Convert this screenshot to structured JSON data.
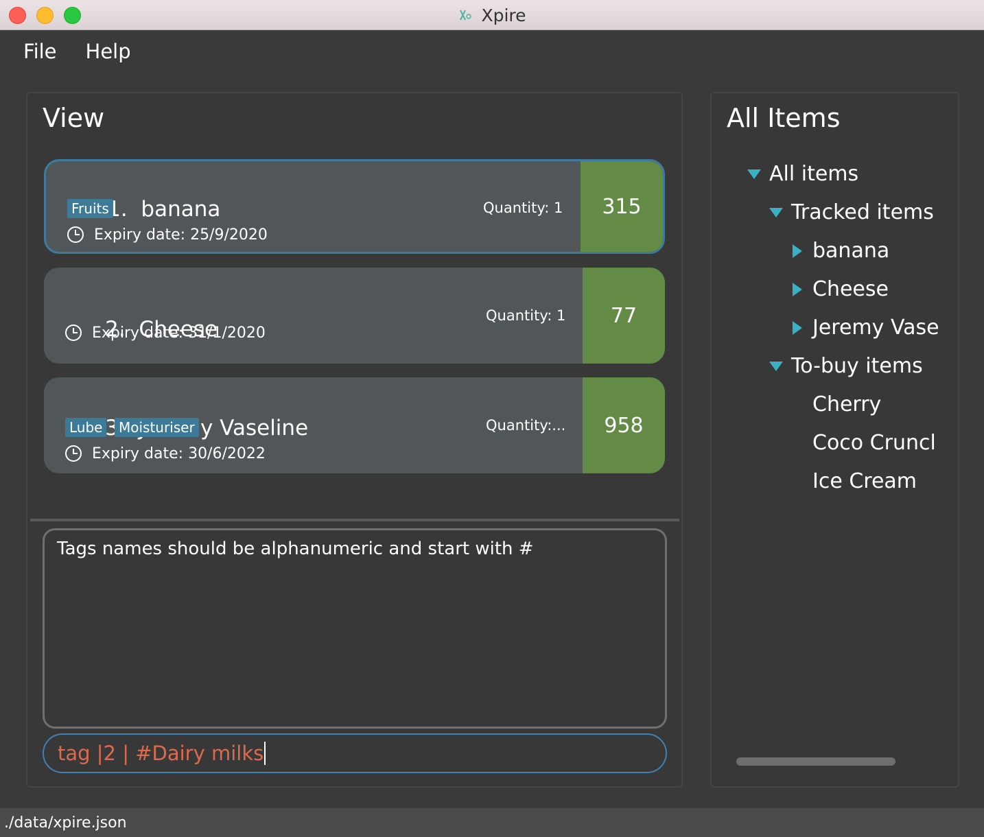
{
  "window": {
    "title": "Xpire",
    "icon": "xpire-logo-icon"
  },
  "menu": {
    "items": [
      "File",
      "Help"
    ]
  },
  "view_panel": {
    "title": "View",
    "cards": [
      {
        "index": "1.",
        "name": "banana",
        "tags": [
          "Fruits"
        ],
        "quantity": "Quantity: 1",
        "expiry": "Expiry date: 25/9/2020",
        "days": "315",
        "selected": true
      },
      {
        "index": "2.",
        "name": "Cheese",
        "tags": [],
        "quantity": "Quantity: 1",
        "expiry": "Expiry date: 31/1/2020",
        "days": "77",
        "selected": false
      },
      {
        "index": "3.",
        "name": "Jeremy Vaseline",
        "tags": [
          "Lube",
          "Moisturiser"
        ],
        "quantity": "Quantity:...",
        "expiry": "Expiry date: 30/6/2022",
        "days": "958",
        "selected": false
      }
    ],
    "badge_color": "#638b45",
    "tag_color": "#3c7a97"
  },
  "result": {
    "text": "Tags names should be alphanumeric and start with #"
  },
  "command": {
    "value": "tag |2 | #Dairy milks",
    "text_color": "#dd6a4d"
  },
  "items_panel": {
    "title": "All Items",
    "tree": {
      "root": "All items",
      "tracked_label": "Tracked items",
      "tracked": [
        "banana",
        "Cheese",
        "Jeremy Vase"
      ],
      "tobuy_label": "To-buy items",
      "tobuy": [
        "Cherry",
        "Coco Cruncl",
        "Ice Cream"
      ]
    }
  },
  "status": {
    "path": "./data/xpire.json"
  }
}
